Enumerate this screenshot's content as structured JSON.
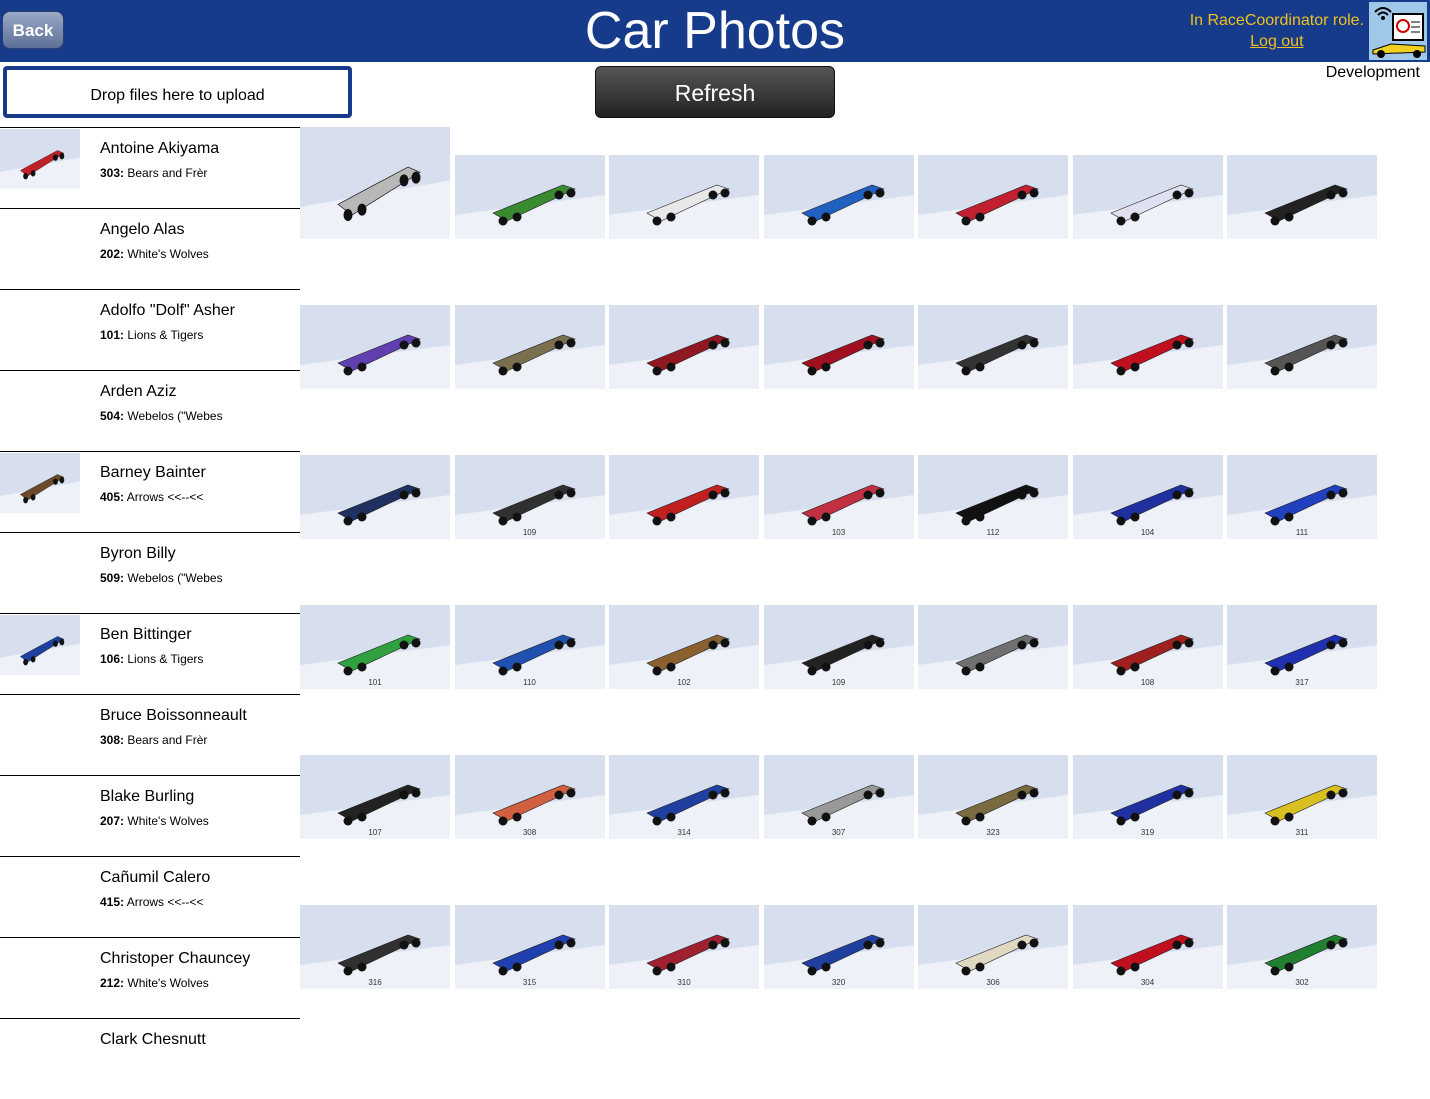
{
  "header": {
    "back_label": "Back",
    "title": "Car Photos",
    "role_text": "In RaceCoordinator role.",
    "logout_label": "Log out",
    "environment": "Development"
  },
  "toolbar": {
    "upload_label": "Drop files here to upload",
    "refresh_label": "Refresh"
  },
  "racers": [
    {
      "name": "Antoine Akiyama",
      "car": "303:",
      "den": "Bears and Frèr",
      "thumb": true,
      "thumb_color": "#c0202a"
    },
    {
      "name": "Angelo Alas",
      "car": "202:",
      "den": "White's Wolves",
      "thumb": false
    },
    {
      "name": "Adolfo \"Dolf\" Asher",
      "car": "101:",
      "den": "Lions & Tigers",
      "thumb": false
    },
    {
      "name": "Arden Aziz",
      "car": "504:",
      "den": "Webelos (\"Webes",
      "thumb": false
    },
    {
      "name": "Barney Bainter",
      "car": "405:",
      "den": "Arrows <<--<<",
      "thumb": true,
      "thumb_color": "#6b4a2a"
    },
    {
      "name": "Byron Billy",
      "car": "509:",
      "den": "Webelos (\"Webes",
      "thumb": false
    },
    {
      "name": "Ben Bittinger",
      "car": "106:",
      "den": "Lions & Tigers",
      "thumb": true,
      "thumb_color": "#2040a0"
    },
    {
      "name": "Bruce Boissonneault",
      "car": "308:",
      "den": "Bears and Frèr",
      "thumb": false
    },
    {
      "name": "Blake Burling",
      "car": "207:",
      "den": "White's Wolves",
      "thumb": false
    },
    {
      "name": "Cañumil Calero",
      "car": "415:",
      "den": "Arrows <<--<<",
      "thumb": false
    },
    {
      "name": "Christoper Chauncey",
      "car": "212:",
      "den": "White's Wolves",
      "thumb": false
    },
    {
      "name": "Clark Chesnutt",
      "car": "",
      "den": "",
      "thumb": false
    }
  ],
  "photos": [
    [
      {
        "color": "#b8b8b8",
        "label": ""
      },
      {
        "color": "#3a8a30",
        "label": ""
      },
      {
        "color": "#e8e8e8",
        "label": ""
      },
      {
        "color": "#2060c0",
        "label": ""
      },
      {
        "color": "#c02030",
        "label": ""
      },
      {
        "color": "#e0e0f0",
        "label": ""
      },
      {
        "color": "#222222",
        "label": ""
      }
    ],
    [
      {
        "color": "#6040b0",
        "label": ""
      },
      {
        "color": "#7a7050",
        "label": ""
      },
      {
        "color": "#901820",
        "label": ""
      },
      {
        "color": "#a01020",
        "label": ""
      },
      {
        "color": "#333333",
        "label": ""
      },
      {
        "color": "#c01020",
        "label": ""
      },
      {
        "color": "#555555",
        "label": ""
      }
    ],
    [
      {
        "color": "#203060",
        "label": ""
      },
      {
        "color": "#303030",
        "label": "109"
      },
      {
        "color": "#c02020",
        "label": ""
      },
      {
        "color": "#c03040",
        "label": "103"
      },
      {
        "color": "#111111",
        "label": "112"
      },
      {
        "color": "#2030a0",
        "label": "104"
      },
      {
        "color": "#2040c0",
        "label": "111"
      }
    ],
    [
      {
        "color": "#30a040",
        "label": "101"
      },
      {
        "color": "#2050b0",
        "label": "110"
      },
      {
        "color": "#8a6030",
        "label": "102"
      },
      {
        "color": "#222222",
        "label": "109"
      },
      {
        "color": "#707070",
        "label": ""
      },
      {
        "color": "#a02020",
        "label": "108"
      },
      {
        "color": "#2030b0",
        "label": "317"
      }
    ],
    [
      {
        "color": "#222222",
        "label": "107"
      },
      {
        "color": "#d06040",
        "label": "308"
      },
      {
        "color": "#2040a0",
        "label": "314"
      },
      {
        "color": "#999999",
        "label": "307"
      },
      {
        "color": "#7a6a40",
        "label": "323"
      },
      {
        "color": "#2030a0",
        "label": "319"
      },
      {
        "color": "#d8c020",
        "label": "311"
      }
    ],
    [
      {
        "color": "#303030",
        "label": "316"
      },
      {
        "color": "#2040b0",
        "label": "315"
      },
      {
        "color": "#a02030",
        "label": "310"
      },
      {
        "color": "#2040a0",
        "label": "320"
      },
      {
        "color": "#e0d8c0",
        "label": "306"
      },
      {
        "color": "#c01020",
        "label": "304"
      },
      {
        "color": "#208030",
        "label": "302"
      }
    ]
  ]
}
